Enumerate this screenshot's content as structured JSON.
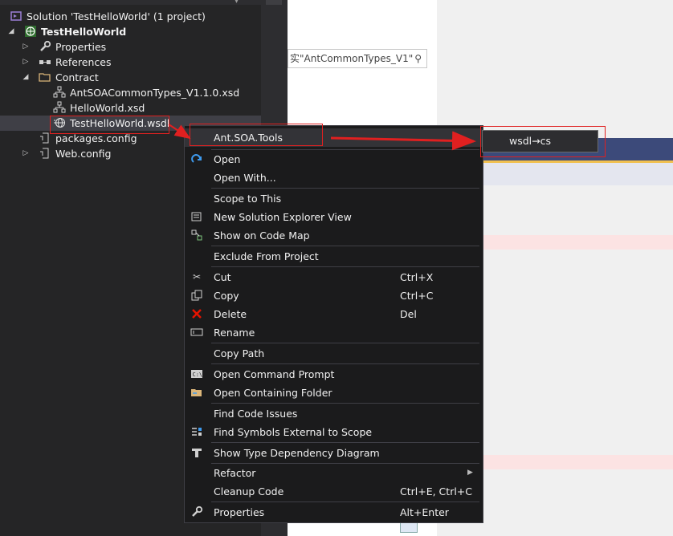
{
  "explorer": {
    "solution_label": "Solution 'TestHelloWorld' (1 project)",
    "project": "TestHelloWorld",
    "items": [
      {
        "label": "Properties",
        "icon": "wrench-icon"
      },
      {
        "label": "References",
        "icon": "references-icon"
      },
      {
        "label": "Contract",
        "icon": "folder-open-icon"
      },
      {
        "label": "AntSOACommonTypes_V1.1.0.xsd",
        "icon": "xsd-file-icon"
      },
      {
        "label": "HelloWorld.xsd",
        "icon": "xsd-file-icon"
      },
      {
        "label": "TestHelloWorld.wsdl",
        "icon": "wsdl-file-icon"
      },
      {
        "label": "packages.config",
        "icon": "config-file-icon"
      },
      {
        "label": "Web.config",
        "icon": "config-file-icon"
      }
    ]
  },
  "editor": {
    "search_text": "实\"AntCommonTypes_V1\"",
    "search_icon": "search-icon"
  },
  "context_menu": {
    "items": [
      {
        "label": "Ant.SOA.Tools",
        "shortcut": ""
      },
      {
        "label": "Open",
        "shortcut": "",
        "icon": "open-arrow-icon"
      },
      {
        "label": "Open With...",
        "shortcut": ""
      },
      {
        "label": "Scope to This",
        "shortcut": ""
      },
      {
        "label": "New Solution Explorer View",
        "shortcut": "",
        "icon": "new-view-icon"
      },
      {
        "label": "Show on Code Map",
        "shortcut": "",
        "icon": "code-map-icon"
      },
      {
        "label": "Exclude From Project",
        "shortcut": ""
      },
      {
        "label": "Cut",
        "shortcut": "Ctrl+X",
        "icon": "scissors-icon"
      },
      {
        "label": "Copy",
        "shortcut": "Ctrl+C",
        "icon": "copy-icon"
      },
      {
        "label": "Delete",
        "shortcut": "Del",
        "icon": "delete-x-icon"
      },
      {
        "label": "Rename",
        "shortcut": "",
        "icon": "rename-icon"
      },
      {
        "label": "Copy Path",
        "shortcut": ""
      },
      {
        "label": "Open Command Prompt",
        "shortcut": "",
        "icon": "command-prompt-icon"
      },
      {
        "label": "Open Containing Folder",
        "shortcut": "",
        "icon": "folder-icon"
      },
      {
        "label": "Find Code Issues",
        "shortcut": ""
      },
      {
        "label": "Find Symbols External to Scope",
        "shortcut": "",
        "icon": "find-symbols-icon"
      },
      {
        "label": "Show Type Dependency Diagram",
        "shortcut": "",
        "icon": "type-dependency-icon"
      },
      {
        "label": "Refactor",
        "shortcut": ""
      },
      {
        "label": "Cleanup Code",
        "shortcut": "Ctrl+E, Ctrl+C"
      },
      {
        "label": "Properties",
        "shortcut": "Alt+Enter",
        "icon": "wrench-icon"
      }
    ]
  },
  "submenu": {
    "items": [
      {
        "label": "wsdl→cs"
      }
    ]
  },
  "colors": {
    "explorer_bg": "#252526",
    "menu_bg": "#1b1b1c",
    "annotation_red": "#e02020",
    "delete_red": "#e51400",
    "open_blue": "#3e9bf0"
  }
}
